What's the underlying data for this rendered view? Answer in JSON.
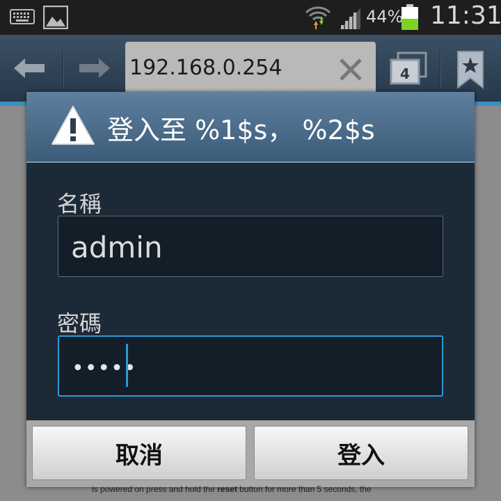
{
  "status_bar": {
    "battery_percent": "44%",
    "battery_level": 0.44,
    "time": "11:31",
    "icons": [
      "keyboard-icon",
      "image-icon",
      "wifi-icon",
      "signal-icon",
      "battery-icon"
    ]
  },
  "toolbar": {
    "url": "192.168.0.254",
    "tab_count": "4",
    "icons": [
      "back-arrow-icon",
      "forward-arrow-icon",
      "clear-icon",
      "tabs-icon",
      "bookmark-icon"
    ]
  },
  "dialog": {
    "title": "登入至 %1$s， %2$s",
    "username_label": "名稱",
    "username_value": "admin",
    "password_label": "密碼",
    "password_masked": "•••••",
    "cancel_label": "取消",
    "login_label": "登入"
  },
  "background_page": {
    "text_before": "is powered on press and hold the ",
    "text_bold": "reset",
    "text_after": " button for more than 5 seconds, the"
  },
  "colors": {
    "accent": "#2a9ad8",
    "battery_fill": "#7ed321",
    "dialog_header": "#4c6d8b",
    "dialog_body": "#1c2a37"
  }
}
